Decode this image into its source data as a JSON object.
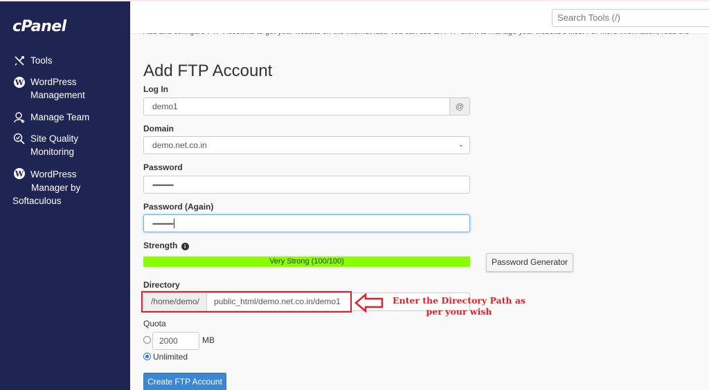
{
  "sidebar": {
    "logo": "cPanel",
    "items": [
      {
        "label_line1": "Tools",
        "label_line2": "",
        "icon": "tools-icon"
      },
      {
        "label_line1": "WordPress",
        "label_line2": "Management",
        "icon": "wordpress-icon"
      },
      {
        "label_line1": "Manage Team",
        "label_line2": "",
        "icon": "add-user-icon"
      },
      {
        "label_line1": "Site Quality",
        "label_line2": "Monitoring",
        "icon": "search-check-icon"
      },
      {
        "label_line1": "WordPress",
        "label_line2": "Manager by",
        "label_line3": "Softaculous",
        "icon": "wordpress-icon"
      }
    ]
  },
  "header": {
    "search_placeholder": "Search Tools (/)"
  },
  "page": {
    "description": "Add and configure FTP Accounts to get your website on the internet fast. You can use an FTP client to manage your website's files. For more information, read the",
    "title": "Add FTP Account"
  },
  "form": {
    "login": {
      "label": "Log In",
      "value": "demo1",
      "addon": "@"
    },
    "domain": {
      "label": "Domain",
      "value": "demo.net.co.in"
    },
    "password": {
      "label": "Password",
      "value": "••••••••••••••"
    },
    "password_again": {
      "label": "Password (Again)",
      "value": "••••••••••••••"
    },
    "strength": {
      "label": "Strength",
      "text": "Very Strong (100/100)",
      "score": 100,
      "max": 100,
      "color": "#88ff00"
    },
    "password_generator_label": "Password Generator",
    "directory": {
      "label": "Directory",
      "prefix": "/home/demo/",
      "value": "public_html/demo.net.co.in/demo1"
    },
    "quota": {
      "label": "Quota",
      "value": "2000",
      "unit": "MB",
      "unlimited_label": "Unlimited",
      "selected": "unlimited"
    },
    "submit_label": "Create FTP Account"
  },
  "annotation": {
    "text": "Enter the Directory Path as per your wish",
    "color": "#e31e24"
  }
}
